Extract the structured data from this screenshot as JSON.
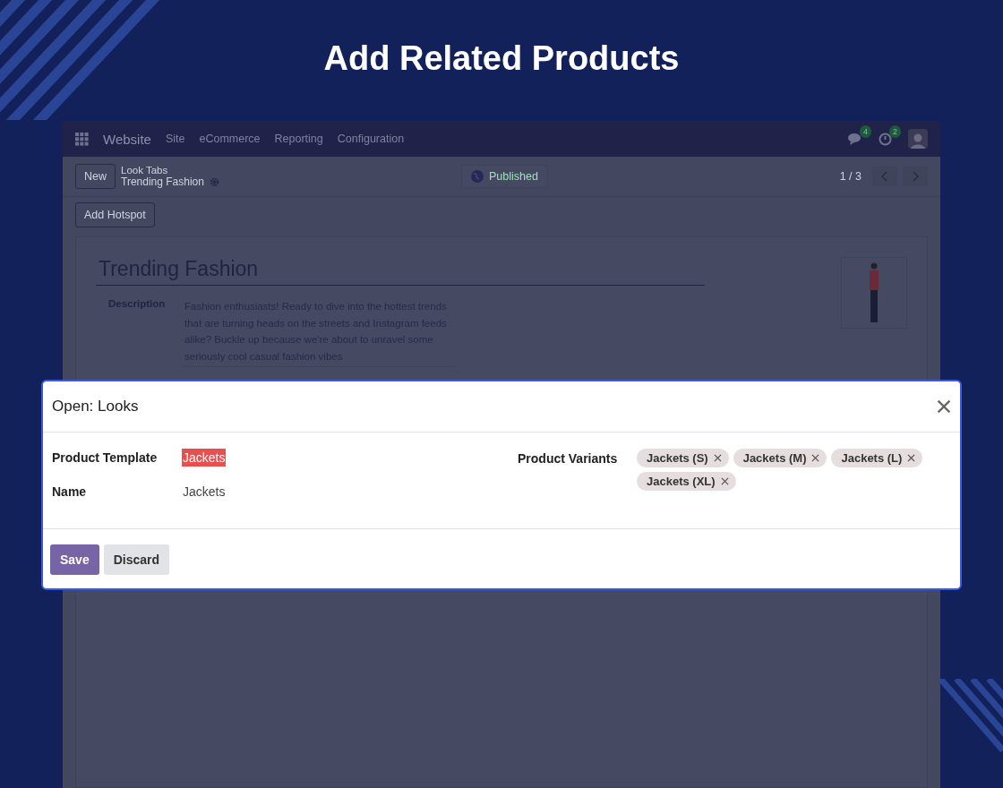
{
  "heading": "Add Related Products",
  "app": {
    "navbar": {
      "app_name": "Website",
      "menu": [
        "Site",
        "eCommerce",
        "Reporting",
        "Configuration"
      ],
      "messages_badge": "4",
      "activities_badge": "2"
    },
    "control_panel": {
      "new_button": "New",
      "breadcrumb": "Look Tabs",
      "record_name": "Trending Fashion",
      "status": "Published",
      "pager": "1 / 3"
    },
    "action_button": "Add Hotspot",
    "form": {
      "title": "Trending Fashion",
      "description_label": "Description",
      "description": "Fashion enthusiasts!  Ready to dive into the hottest trends that are turning heads on the streets and Instagram feeds alike? Buckle up because we're about to unravel some seriously cool casual fashion vibes"
    }
  },
  "dialog": {
    "title": "Open: Looks",
    "fields": [
      {
        "label": "Product Template",
        "value": "Jackets",
        "highlighted": true
      },
      {
        "label": "Name",
        "value": "Jackets",
        "highlighted": false
      }
    ],
    "variants_label": "Product Variants",
    "variants": [
      "Jackets (S)",
      "Jackets (M)",
      "Jackets (L)",
      "Jackets (XL)"
    ],
    "buttons": [
      {
        "label": "Save",
        "kind": "primary"
      },
      {
        "label": "Discard",
        "kind": "secondary"
      }
    ]
  }
}
